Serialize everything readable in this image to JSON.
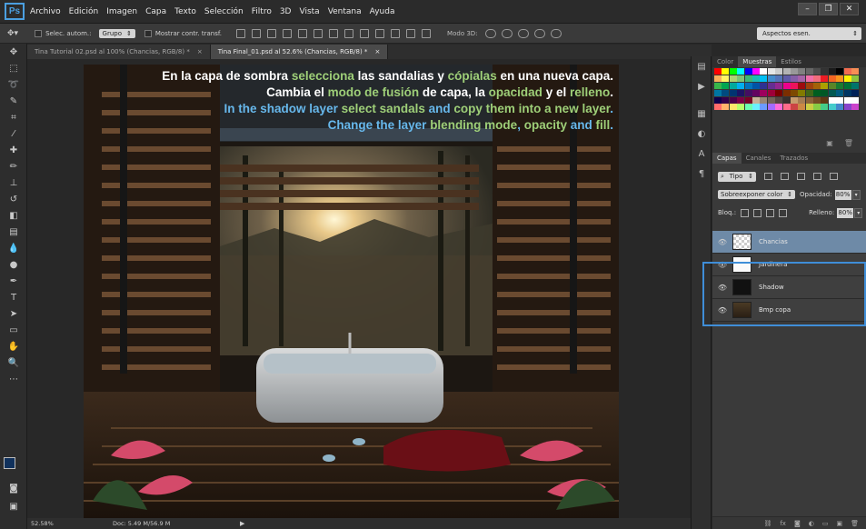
{
  "app": {
    "logo": "Ps"
  },
  "menu": [
    "Archivo",
    "Edición",
    "Imagen",
    "Capa",
    "Texto",
    "Selección",
    "Filtro",
    "3D",
    "Vista",
    "Ventana",
    "Ayuda"
  ],
  "window_controls": [
    "–",
    "❐",
    "✕"
  ],
  "options": {
    "auto_select_label": "Selec. autom.:",
    "auto_select_value": "Grupo",
    "show_transform_label": "Mostrar contr. transf.",
    "mode_3d_label": "Modo 3D:",
    "workspace": "Aspectos esen."
  },
  "tabs": [
    {
      "label": "Tina Tutorial 02.psd al 100% (Chancias, RGB/8) *",
      "close": "×"
    },
    {
      "label": "Tina Final_01.psd al 52.6% (Chancias, RGB/8) *",
      "close": "×"
    }
  ],
  "caption": {
    "line1": {
      "a": "En la capa de sombra ",
      "b": "selecciona",
      "c": " las sandalias y ",
      "d": "cópialas",
      "e": " en una nueva capa."
    },
    "line2": {
      "a": "Cambia el ",
      "b": "modo de fusión",
      "c": " de capa, la ",
      "d": "opacidad",
      "e": " y el ",
      "f": "relleno",
      "g": "."
    },
    "line3": {
      "a": "In the shadow layer ",
      "b": "select sandals",
      "c": " and ",
      "d": "copy them into a new layer",
      "e": "."
    },
    "line4": {
      "a": "Change the layer ",
      "b": "blending mode",
      "c": ", ",
      "d": "opacity",
      "e": " and ",
      "f": "fill",
      "g": "."
    }
  },
  "status": {
    "zoom": "52.58%",
    "doc": "Doc: 5.49 M/56.9 M"
  },
  "swatches_panel": {
    "tabs": [
      "Color",
      "Muestras",
      "Estilos"
    ]
  },
  "layers_panel": {
    "tabs": [
      "Capas",
      "Canales",
      "Trazados"
    ],
    "filter_kind": "Tipo",
    "blend_mode": "Sobreexponer color",
    "opacity_label": "Opacidad:",
    "opacity_value": "80%",
    "lock_label": "Bloq.:",
    "fill_label": "Relleno:",
    "fill_value": "80%",
    "layers": [
      {
        "name": "Chancias",
        "selected": true
      },
      {
        "name": "Jardinera",
        "selected": false
      },
      {
        "name": "Shadow",
        "selected": false
      },
      {
        "name": "Bmp copa",
        "selected": false
      }
    ]
  },
  "colors": {
    "accent_blue": "#3f8ed8",
    "caption_green": "#9ecf78",
    "caption_blue": "#67b8ec",
    "selected_layer": "#6e8aa7"
  }
}
